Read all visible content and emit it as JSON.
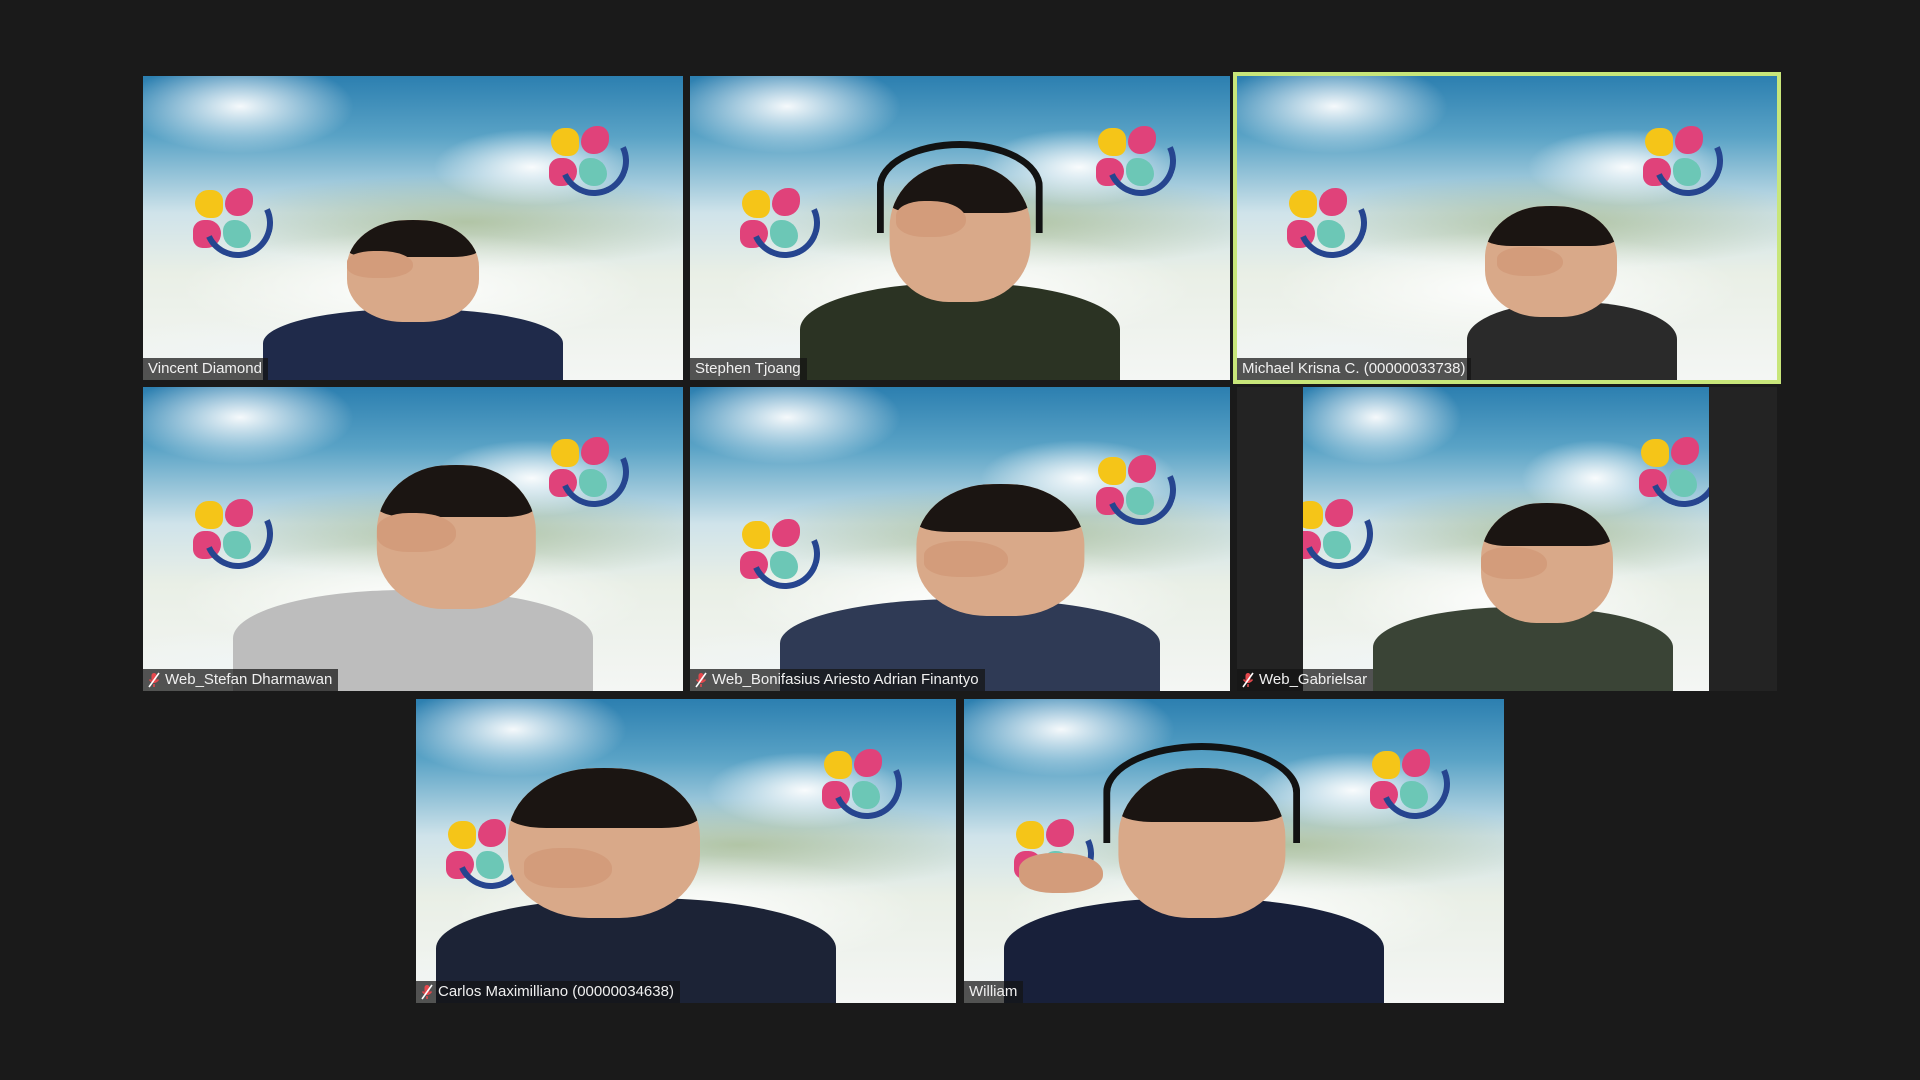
{
  "meeting": {
    "layout": "gallery-view",
    "active_speaker_color": "#c8e67a",
    "muted_icon_color": "#e5484d",
    "participants": [
      {
        "name": "Vincent Diamond",
        "muted": false,
        "active": false,
        "shirt": "#1f2a4a"
      },
      {
        "name": "Stephen Tjoang",
        "muted": false,
        "active": false,
        "shirt": "#2b3323"
      },
      {
        "name": "Michael Krisna C. (00000033738)",
        "muted": false,
        "active": true,
        "shirt": "#2a2a2a"
      },
      {
        "name": "Web_Stefan Dharmawan",
        "muted": true,
        "active": false,
        "shirt": "#bdbdbd"
      },
      {
        "name": "Web_Bonifasius Ariesto Adrian Finantyo",
        "muted": true,
        "active": false,
        "shirt": "#2f3a55"
      },
      {
        "name": "Web_Gabrielsar",
        "muted": true,
        "active": false,
        "shirt": "#3a4436"
      },
      {
        "name": "Carlos Maximilliano (00000034638)",
        "muted": true,
        "active": false,
        "shirt": "#1c2336"
      },
      {
        "name": "William",
        "muted": false,
        "active": false,
        "shirt": "#18203a"
      }
    ]
  }
}
